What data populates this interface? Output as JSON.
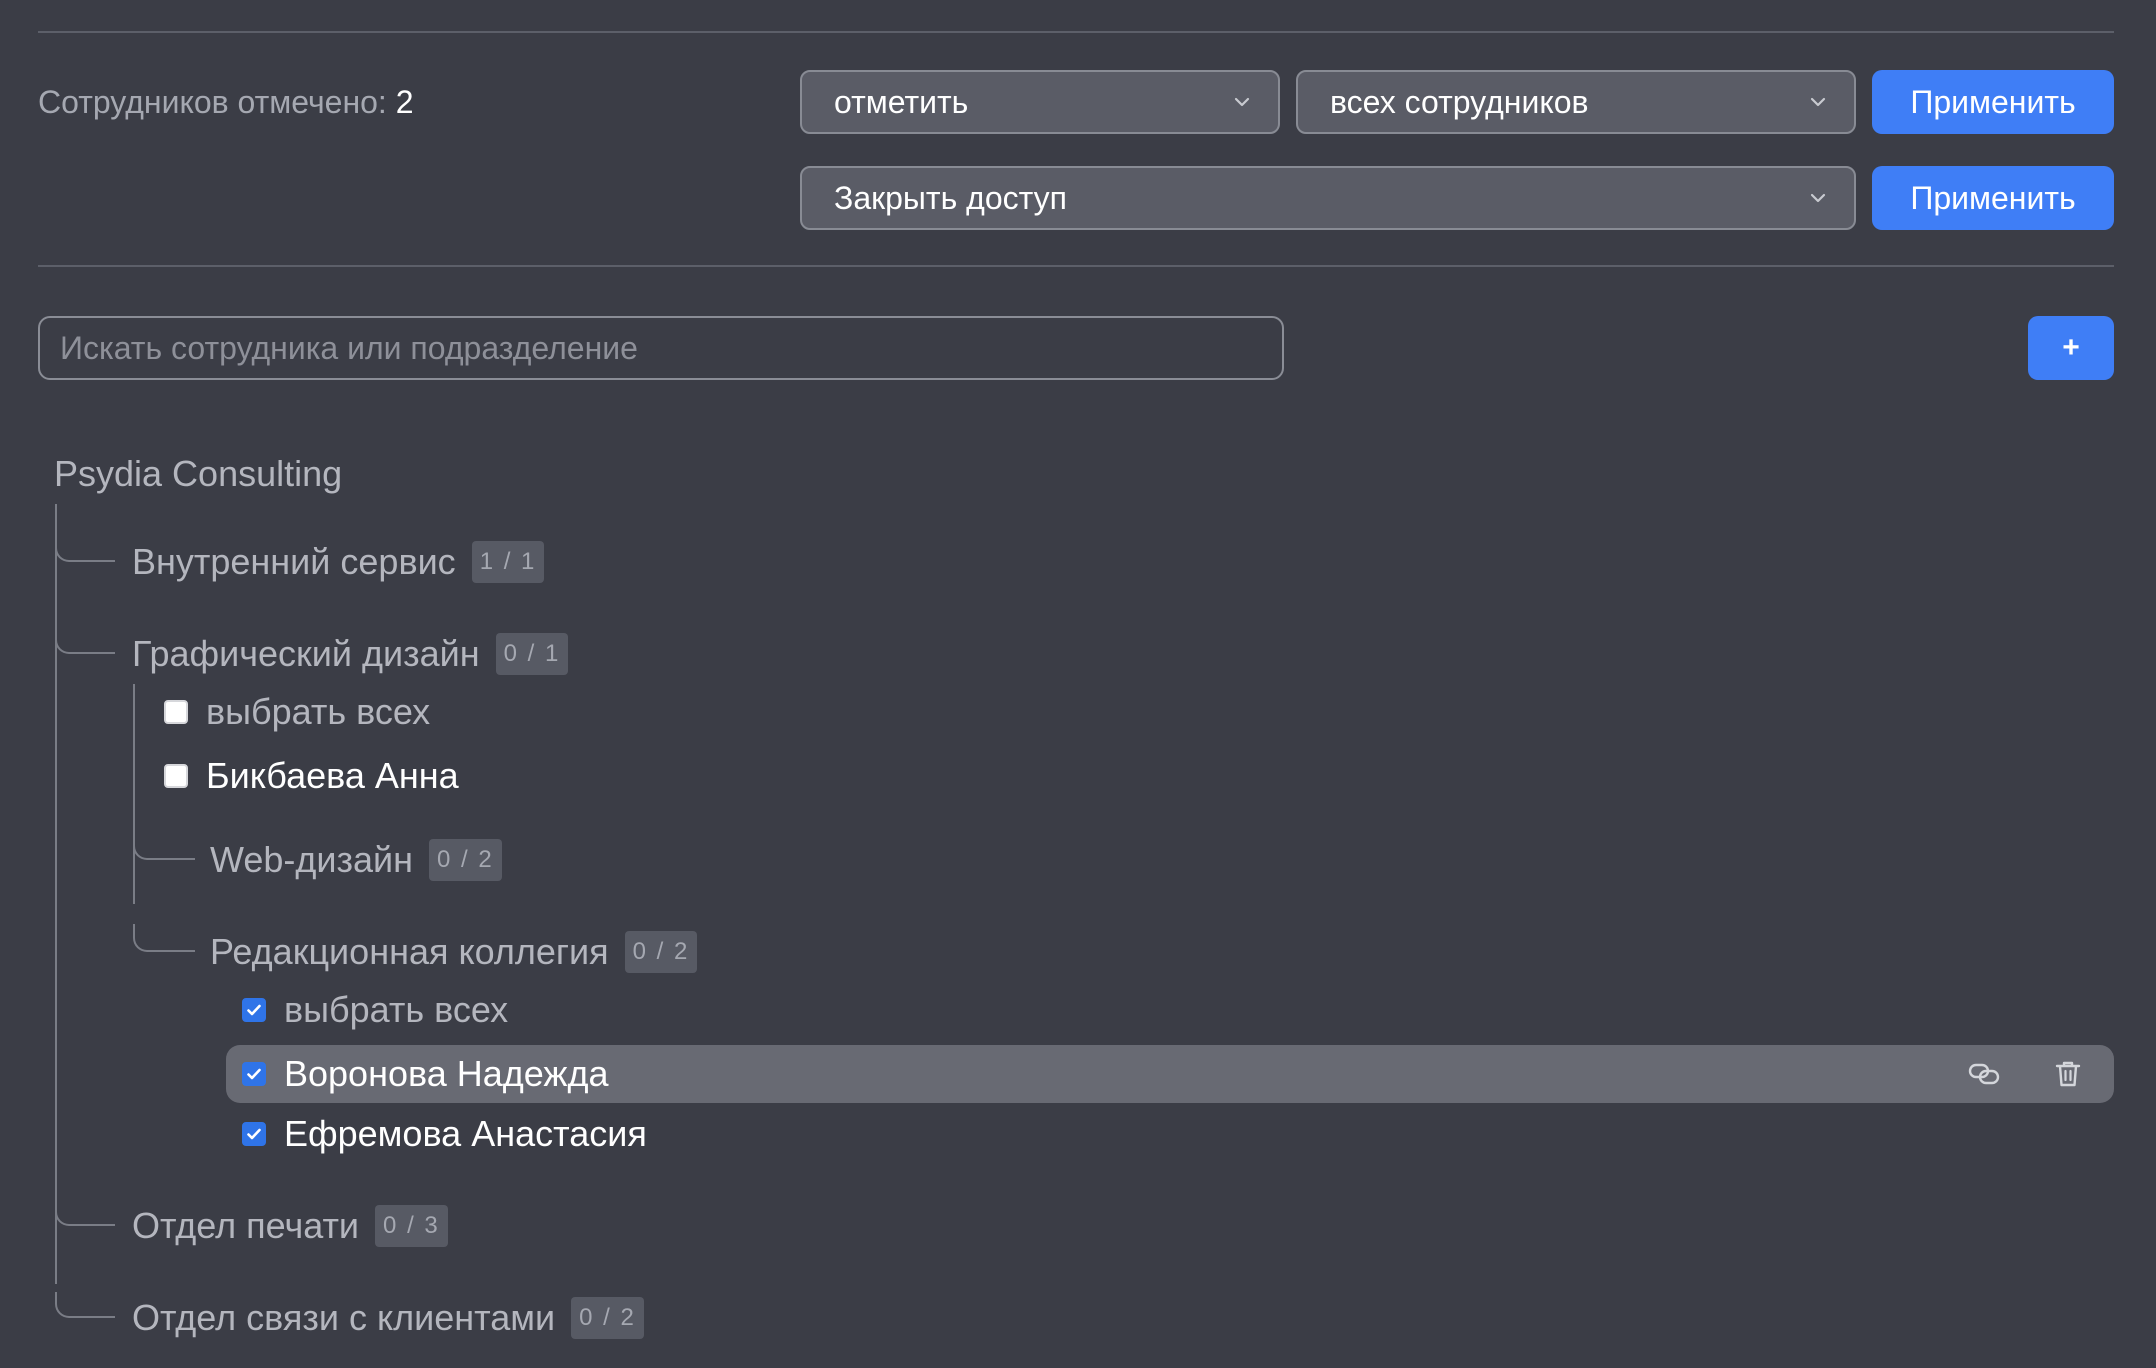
{
  "bulk": {
    "selected_label": "Сотрудников отмечено:",
    "selected_count": "2",
    "action_select": "отметить",
    "scope_select": "всех сотрудников",
    "apply_label": "Применить",
    "access_select": "Закрыть доступ",
    "apply2_label": "Применить"
  },
  "search": {
    "placeholder": "Искать сотрудника или подразделение",
    "value": ""
  },
  "add_button": "+",
  "tree": {
    "org": "Psydia Consulting",
    "depts": [
      {
        "name": "Внутренний сервис",
        "badge": "1 / 1"
      },
      {
        "name": "Графический дизайн",
        "badge": "0 / 1"
      },
      {
        "name": "Web-дизайн",
        "badge": "0 / 2"
      },
      {
        "name": "Редакционная коллегия",
        "badge": "0 / 2"
      },
      {
        "name": "Отдел печати",
        "badge": "0 / 3"
      },
      {
        "name": "Отдел связи с клиентами",
        "badge": "0 / 2"
      }
    ],
    "graphic": {
      "select_all": "выбрать всех",
      "select_all_checked": false,
      "employees": [
        {
          "name": "Бикбаева Анна",
          "checked": false
        }
      ]
    },
    "editorial": {
      "select_all": "выбрать всех",
      "select_all_checked": true,
      "employees": [
        {
          "name": "Воронова Надежда",
          "checked": true
        },
        {
          "name": "Ефремова Анастасия",
          "checked": true
        }
      ]
    }
  },
  "colors": {
    "background": "#3b3d46",
    "accent": "#3f7ef6",
    "checkbox_checked": "#2f74e8",
    "row_highlight": "#686a73"
  },
  "icons": {
    "dropdown": "chevron-down-icon",
    "checkbox": "checkmark-icon",
    "row_actions": [
      "copy-link-icon",
      "trash-icon"
    ]
  }
}
